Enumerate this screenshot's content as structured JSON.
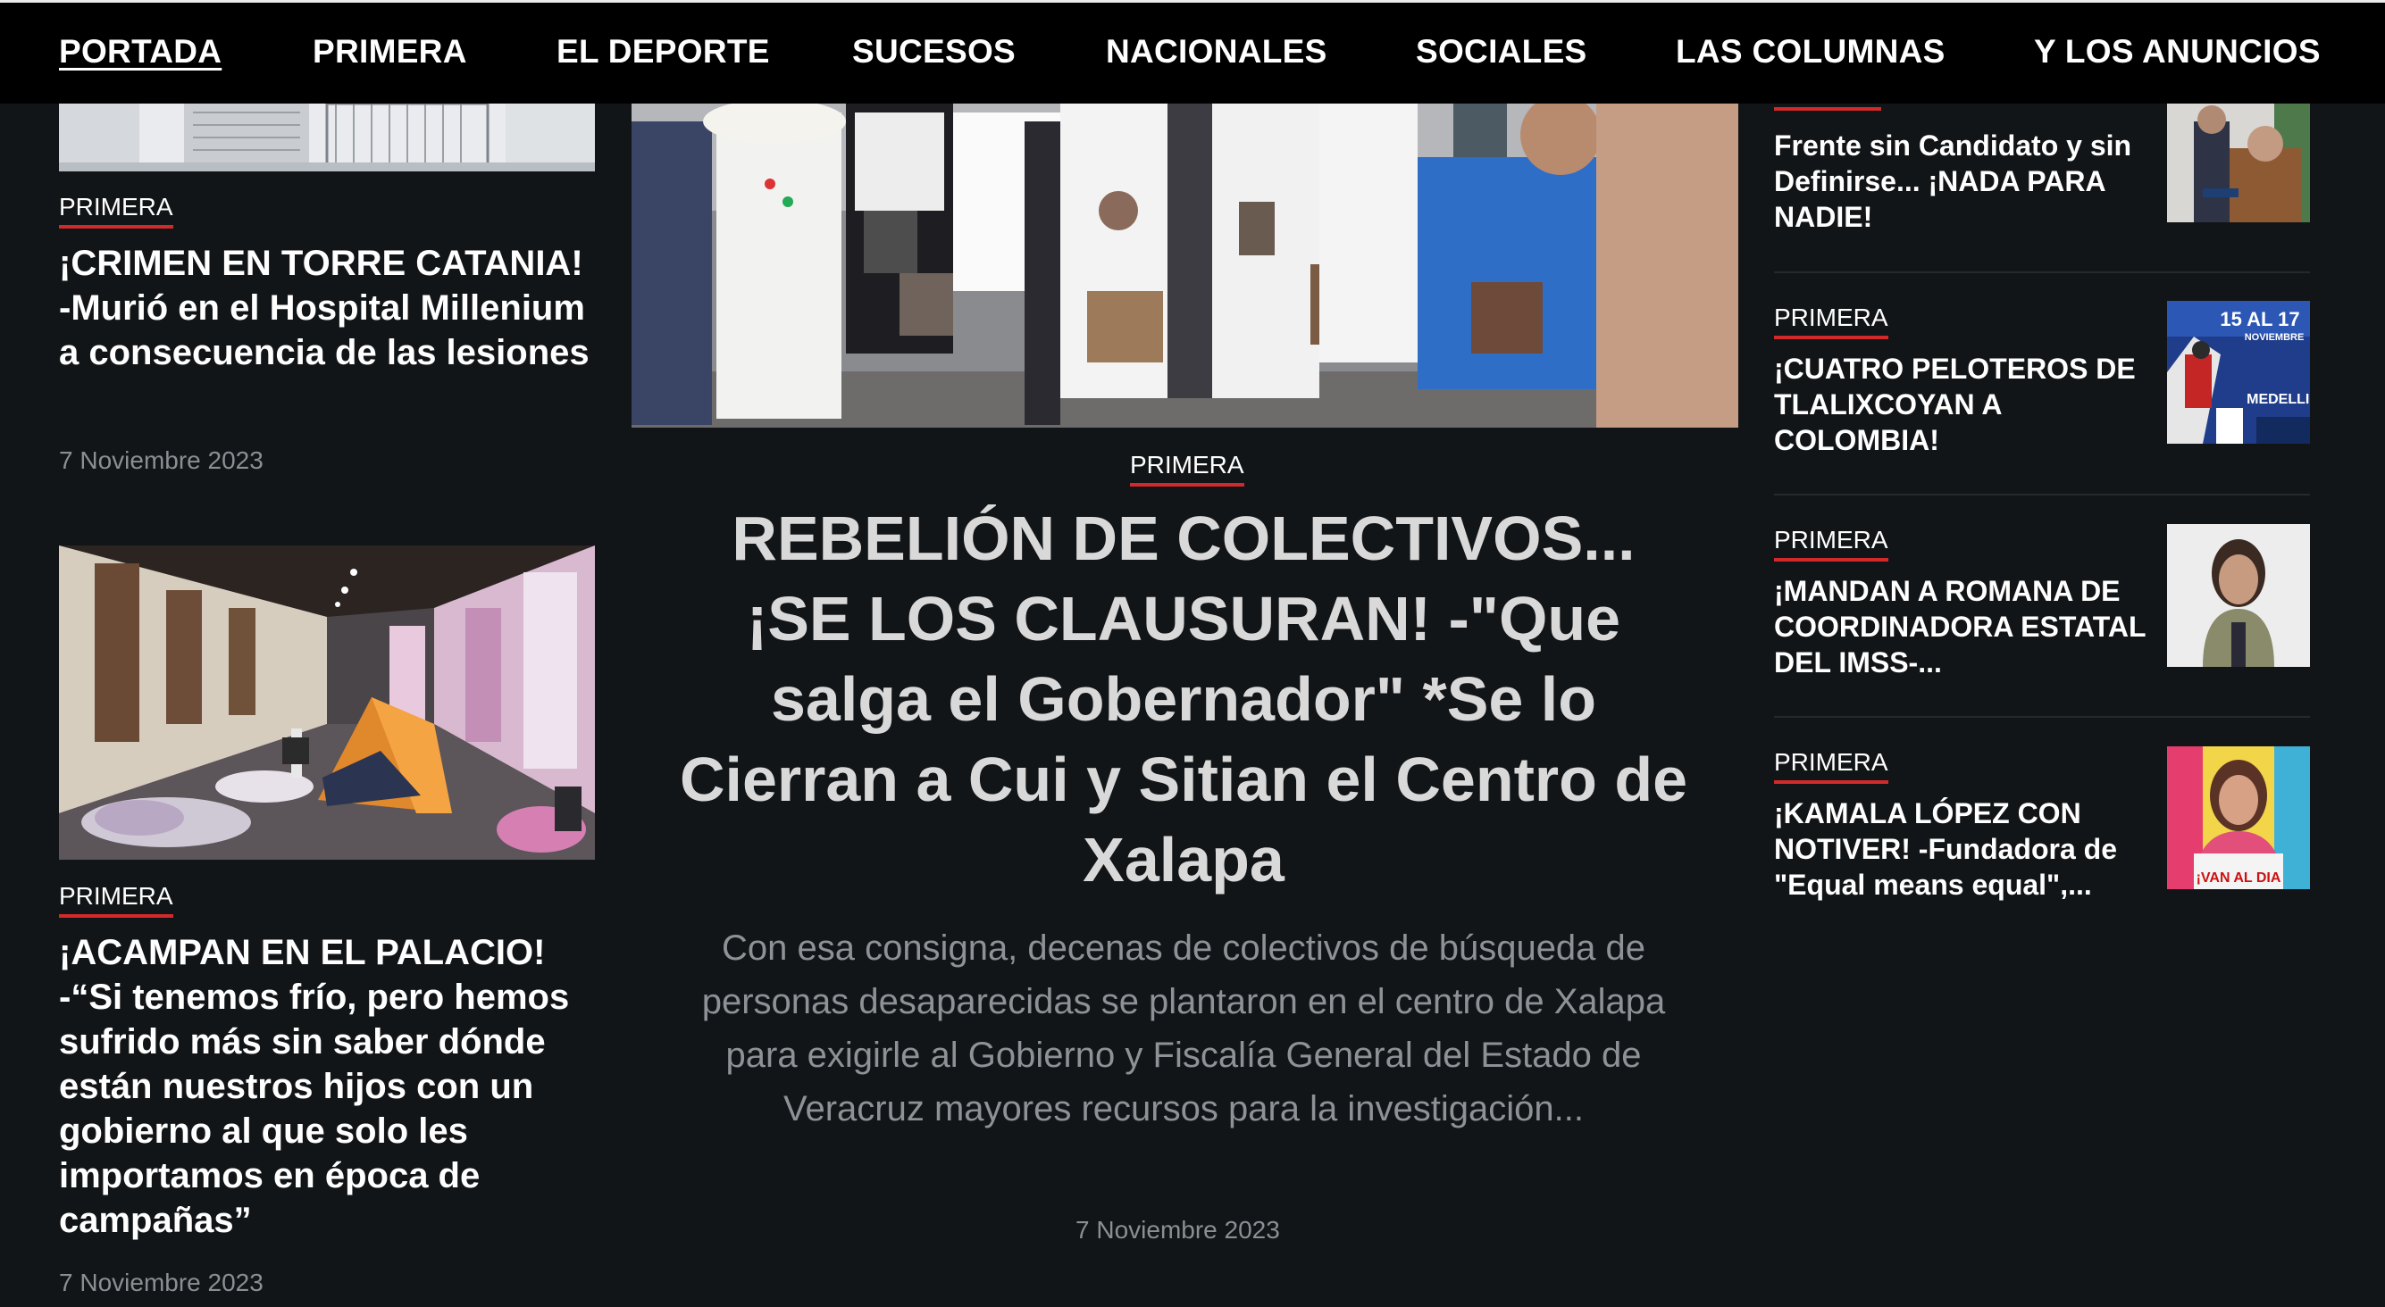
{
  "nav": {
    "items": [
      "PORTADA",
      "PRIMERA",
      "EL DEPORTE",
      "SUCESOS",
      "NACIONALES",
      "SOCIALES",
      "LAS COLUMNAS",
      "Y LOS ANUNCIOS"
    ]
  },
  "left": {
    "article1": {
      "category": "PRIMERA",
      "headline": "¡CRIMEN EN TORRE CATANIA! -Murió en el Hospital Millenium a consecuencia de las lesiones",
      "date": "7 Noviembre 2023"
    },
    "article2": {
      "category": "PRIMERA",
      "headline": "¡ACAMPAN EN EL PALACIO! -“Si tenemos frío, pero hemos sufrido más sin saber dónde están nuestros hijos con un gobierno al que solo les importamos en época de campañas”",
      "date": "7 Noviembre 2023"
    }
  },
  "featured": {
    "category": "PRIMERA",
    "title": "REBELIÓN DE COLECTIVOS... ¡SE LOS CLAUSURAN! -\"Que salga el Gobernador\" *Se lo Cierran a Cui y Sitian el Centro de Xalapa",
    "excerpt": "Con esa consigna, decenas de colectivos de búsqueda de personas desaparecidas se plantaron en el centro de Xalapa para exigirle al Gobierno y Fiscalía General del Estado de Veracruz mayores recursos para la investigación...",
    "date": "7 Noviembre 2023"
  },
  "right": {
    "items": [
      {
        "category": "",
        "title": "Frente sin Candidato y sin Definirse... ¡NADA PARA NADIE!"
      },
      {
        "category": "PRIMERA",
        "title": "¡CUATRO PELOTEROS DE TLALIXCOYAN A COLOMBIA!",
        "thumb_text_top": "15 AL 17",
        "thumb_text_mid": "NOVIEMBRE",
        "thumb_text_bottom": "MEDELLIN"
      },
      {
        "category": "PRIMERA",
        "title": "¡MANDAN A ROMANA DE COORDINADORA ESTATAL DEL IMSS-..."
      },
      {
        "category": "PRIMERA",
        "title": "¡KAMALA LÓPEZ CON NOTIVER! -Fundadora de \"Equal means equal\",...",
        "thumb_text_bottom": "¡VAN AL DIA"
      }
    ]
  },
  "colors": {
    "background": "#121517",
    "nav_background": "#000000",
    "accent": "#d22a2a",
    "muted": "#8b8f93"
  }
}
